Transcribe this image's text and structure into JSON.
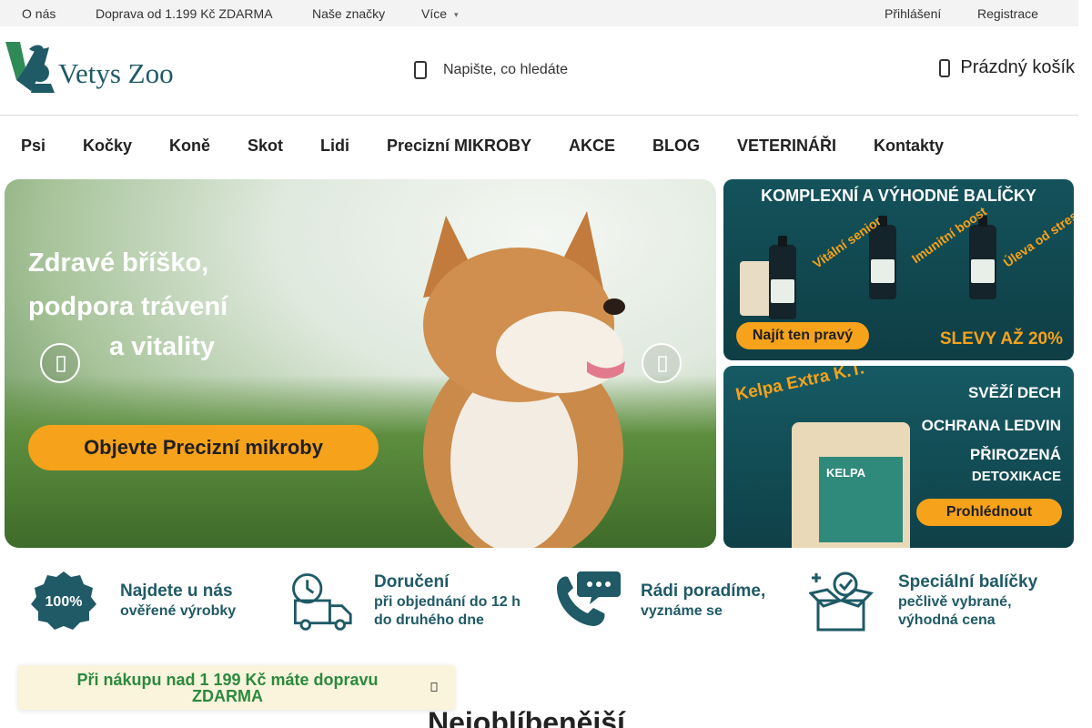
{
  "topbar": {
    "links": [
      "O nás",
      "Doprava od 1.199 Kč ZDARMA",
      "Naše značky"
    ],
    "more": "Více",
    "login": "Přihlášení",
    "register": "Registrace"
  },
  "header": {
    "logo_text": "Vetys Zoo",
    "search_placeholder": "Napište, co hledáte",
    "cart_label": "Prázdný košík"
  },
  "nav": {
    "items": [
      "Psi",
      "Kočky",
      "Koně",
      "Skot",
      "Lidi",
      "Precizní MIKROBY",
      "AKCE",
      "BLOG",
      "VETERINÁŘI",
      "Kontakty"
    ]
  },
  "hero": {
    "lines": [
      "Zdravé bříško,",
      "podpora trávení",
      "a vitality"
    ],
    "cta": "Objevte Precizní mikroby"
  },
  "banner1": {
    "title": "KOMPLEXNÍ A VÝHODNÉ BALÍČKY",
    "tags": [
      "Vitální senior",
      "Imunitní boost",
      "Úleva od stresu"
    ],
    "button": "Najít ten pravý",
    "sale": "SLEVY AŽ 20%"
  },
  "banner2": {
    "product": "Kelpa Extra K.T.",
    "benefits": [
      "SVĚŽÍ DECH",
      "OCHRANA LEDVIN",
      "PŘIROZENÁ",
      "DETOXIKACE"
    ],
    "pouch_label": "KELPA",
    "button": "Prohlédnout"
  },
  "usps": [
    {
      "line1": "Najdete u nás",
      "line2": "ověřené výrobky",
      "icon": "badge-100-icon"
    },
    {
      "line1": "Doručení",
      "line2": "při objednání do 12 h",
      "line3": "do druhého dne",
      "icon": "delivery-truck-icon"
    },
    {
      "line1": "Rádi poradíme,",
      "line2": "vyznáme se",
      "icon": "phone-chat-icon"
    },
    {
      "line1": "Speciální balíčky",
      "line2": "pečlivě vybrané,",
      "line3": "výhodná cena",
      "icon": "gift-box-icon"
    }
  ],
  "toast": {
    "text": "Při nákupu nad 1 199 Kč máte dopravu ZDARMA"
  },
  "section": {
    "title": "Nejoblíbenější"
  },
  "colors": {
    "brand_teal": "#1f5a66",
    "accent_orange": "#f6a21b",
    "toast_green": "#2b8a3e"
  }
}
